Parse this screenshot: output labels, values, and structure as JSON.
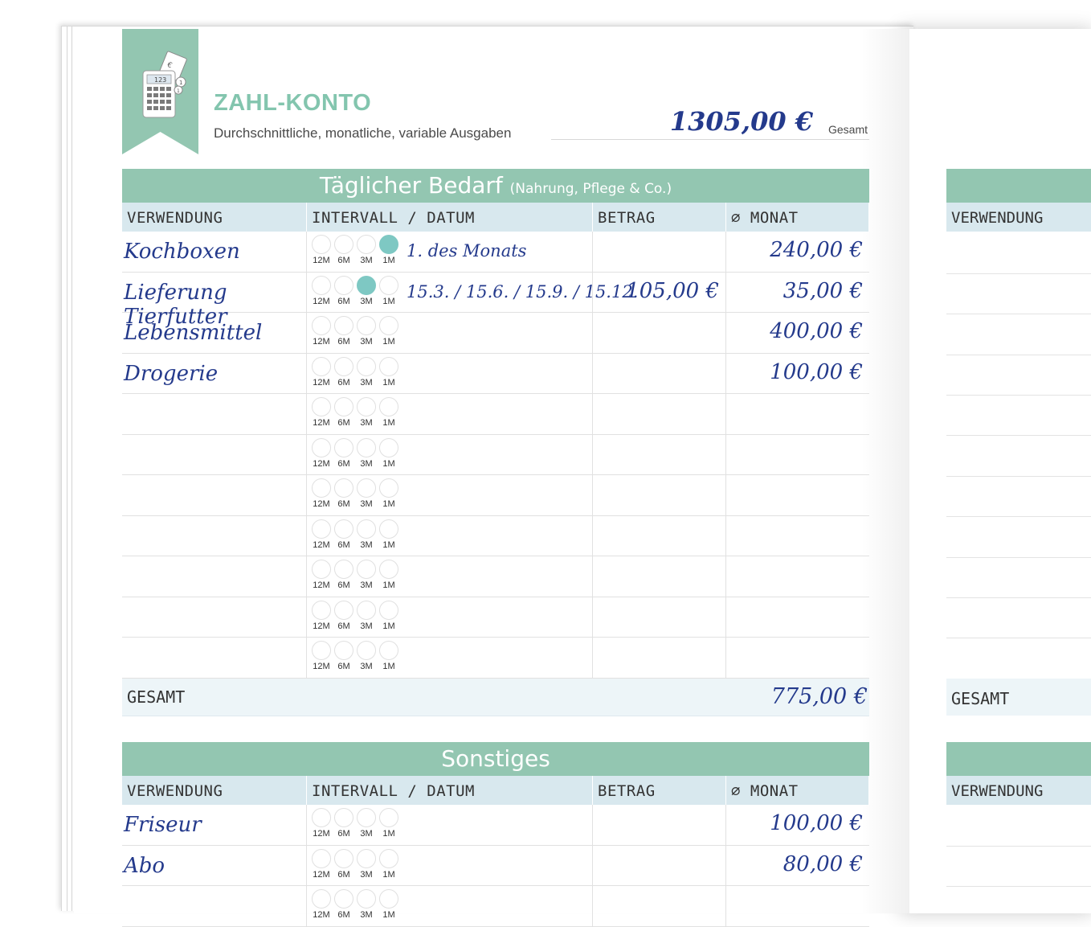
{
  "header": {
    "title": "ZAHL-KONTO",
    "subtitle": "Durchschnittliche, monatliche, variable Ausgaben",
    "total_amount": "1305,00 €",
    "total_label": "Gesamt",
    "icon": "calculator-icon",
    "calc_display": "123"
  },
  "columns": {
    "verwendung": "VERWENDUNG",
    "intervall": "INTERVALL / DATUM",
    "betrag": "BETRAG",
    "monat": "∅ MONAT"
  },
  "interval_labels": [
    "12M",
    "6M",
    "3M",
    "1M"
  ],
  "sections": [
    {
      "title": "Täglicher Bedarf",
      "subtitle": "(Nahrung, Pflege & Co.)",
      "rows": [
        {
          "name": "Kochboxen",
          "selected": "1M",
          "datum": "1. des Monats",
          "betrag": "",
          "monat": "240,00 €"
        },
        {
          "name": "Lieferung Tierfutter",
          "selected": "3M",
          "datum": "15.3. / 15.6. / 15.9. / 15.12.",
          "betrag": "105,00 €",
          "monat": "35,00 €"
        },
        {
          "name": "Lebensmittel",
          "selected": "",
          "datum": "",
          "betrag": "",
          "monat": "400,00 €"
        },
        {
          "name": "Drogerie",
          "selected": "",
          "datum": "",
          "betrag": "",
          "monat": "100,00 €"
        },
        {
          "name": "",
          "selected": "",
          "datum": "",
          "betrag": "",
          "monat": ""
        },
        {
          "name": "",
          "selected": "",
          "datum": "",
          "betrag": "",
          "monat": ""
        },
        {
          "name": "",
          "selected": "",
          "datum": "",
          "betrag": "",
          "monat": ""
        },
        {
          "name": "",
          "selected": "",
          "datum": "",
          "betrag": "",
          "monat": ""
        },
        {
          "name": "",
          "selected": "",
          "datum": "",
          "betrag": "",
          "monat": ""
        },
        {
          "name": "",
          "selected": "",
          "datum": "",
          "betrag": "",
          "monat": ""
        },
        {
          "name": "",
          "selected": "",
          "datum": "",
          "betrag": "",
          "monat": ""
        }
      ],
      "gesamt_label": "GESAMT",
      "gesamt_value": "775,00 €"
    },
    {
      "title": "Sonstiges",
      "subtitle": "",
      "rows": [
        {
          "name": "Friseur",
          "selected": "",
          "datum": "",
          "betrag": "",
          "monat": "100,00 €"
        },
        {
          "name": "Abo",
          "selected": "",
          "datum": "",
          "betrag": "",
          "monat": "80,00 €"
        },
        {
          "name": "",
          "selected": "",
          "datum": "",
          "betrag": "",
          "monat": ""
        }
      ]
    }
  ],
  "right_page": {
    "verwendung": "VERWENDUNG",
    "gesamt": "GESAMT"
  },
  "colors": {
    "accent": "#93c6b1",
    "title_green": "#83c5ae",
    "header_blue": "#d8e8ee",
    "ink": "#243a8c",
    "selected_circle": "#7ec8c3"
  }
}
